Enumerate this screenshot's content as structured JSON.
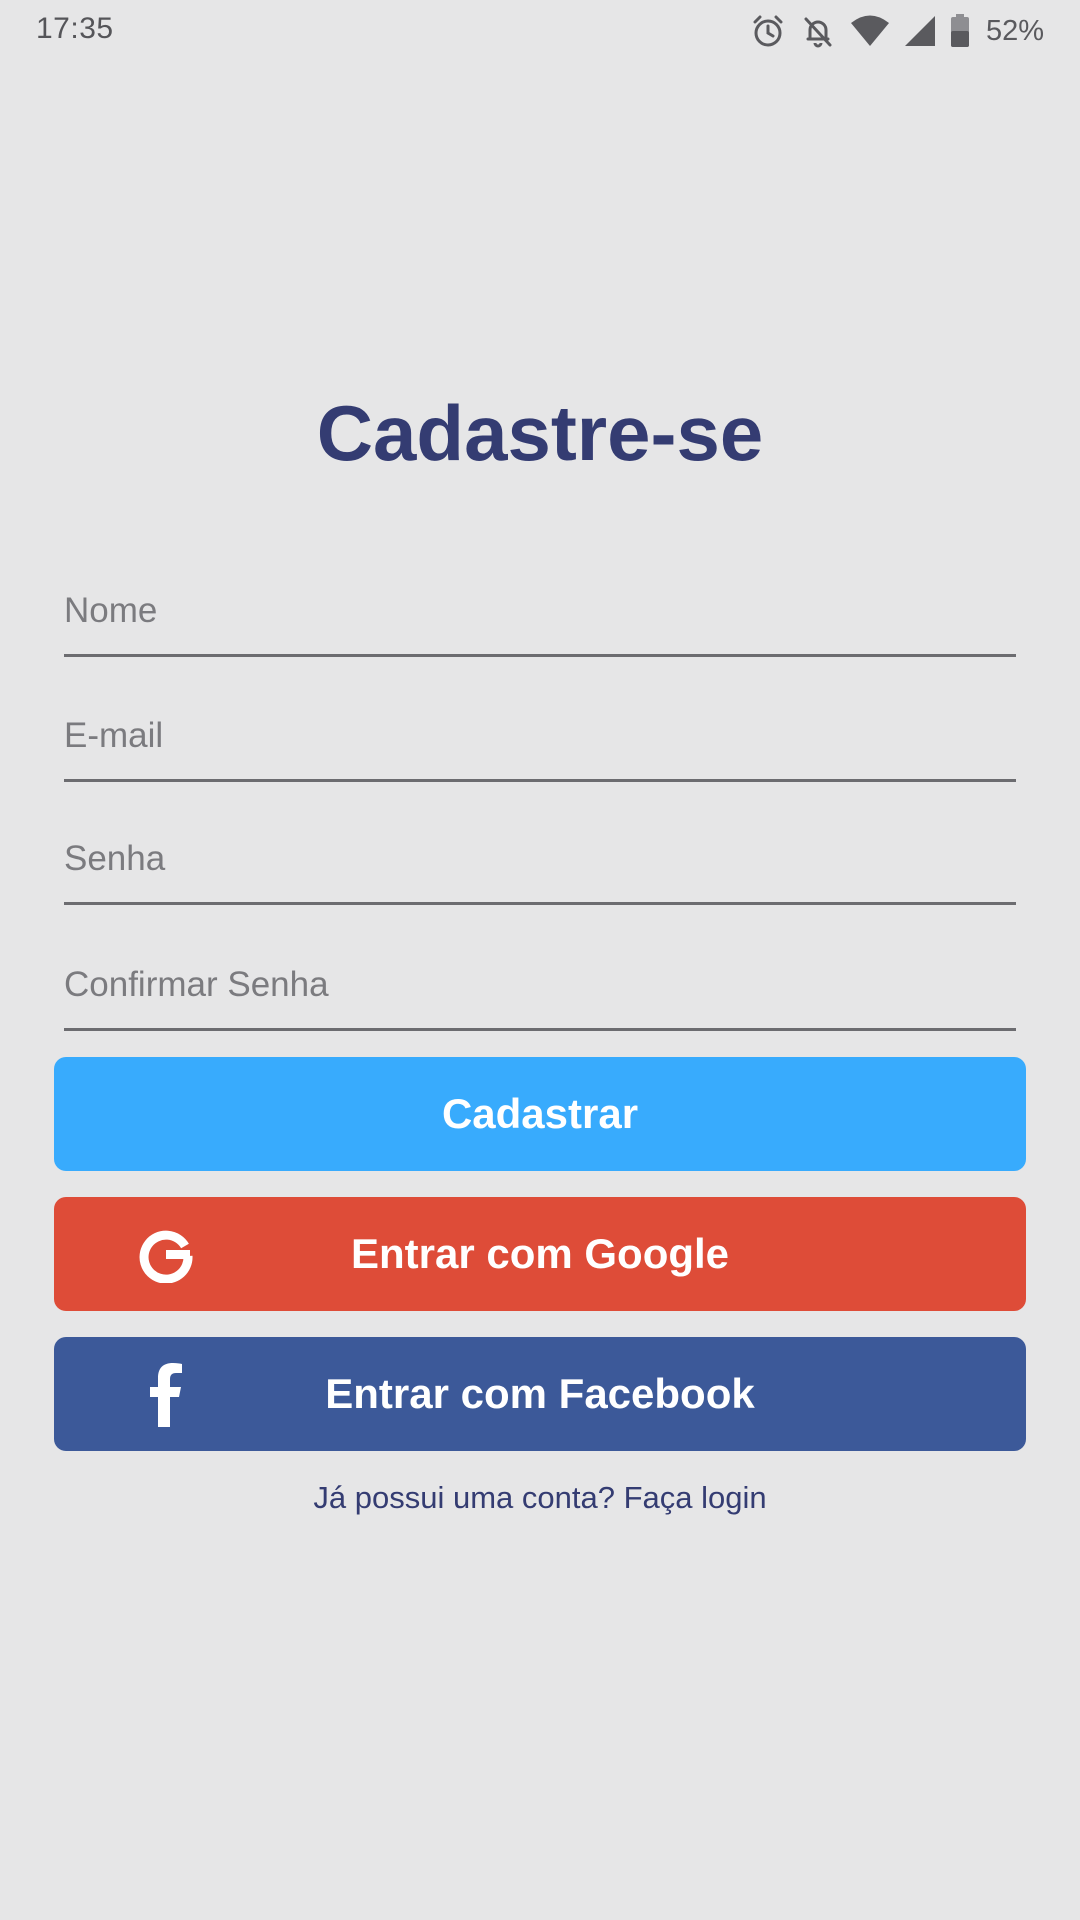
{
  "status_bar": {
    "time": "17:35",
    "battery_percent": "52%",
    "icons": [
      "alarm-icon",
      "notifications-off-icon",
      "wifi-icon",
      "signal-icon",
      "battery-icon"
    ]
  },
  "page": {
    "title": "Cadastre-se"
  },
  "form": {
    "name_placeholder": "Nome",
    "name_value": "",
    "email_placeholder": "E-mail",
    "email_value": "",
    "password_placeholder": "Senha",
    "password_value": "",
    "confirm_password_placeholder": "Confirmar Senha",
    "confirm_password_value": ""
  },
  "buttons": {
    "register_label": "Cadastrar",
    "google_label": "Entrar com Google",
    "facebook_label": "Entrar com Facebook"
  },
  "footer": {
    "login_link": "Já possui uma conta? Faça login"
  },
  "colors": {
    "background": "#e6e6e7",
    "title": "#343c72",
    "primary": "#38abfd",
    "google": "#de4c38",
    "facebook": "#3c5999"
  }
}
